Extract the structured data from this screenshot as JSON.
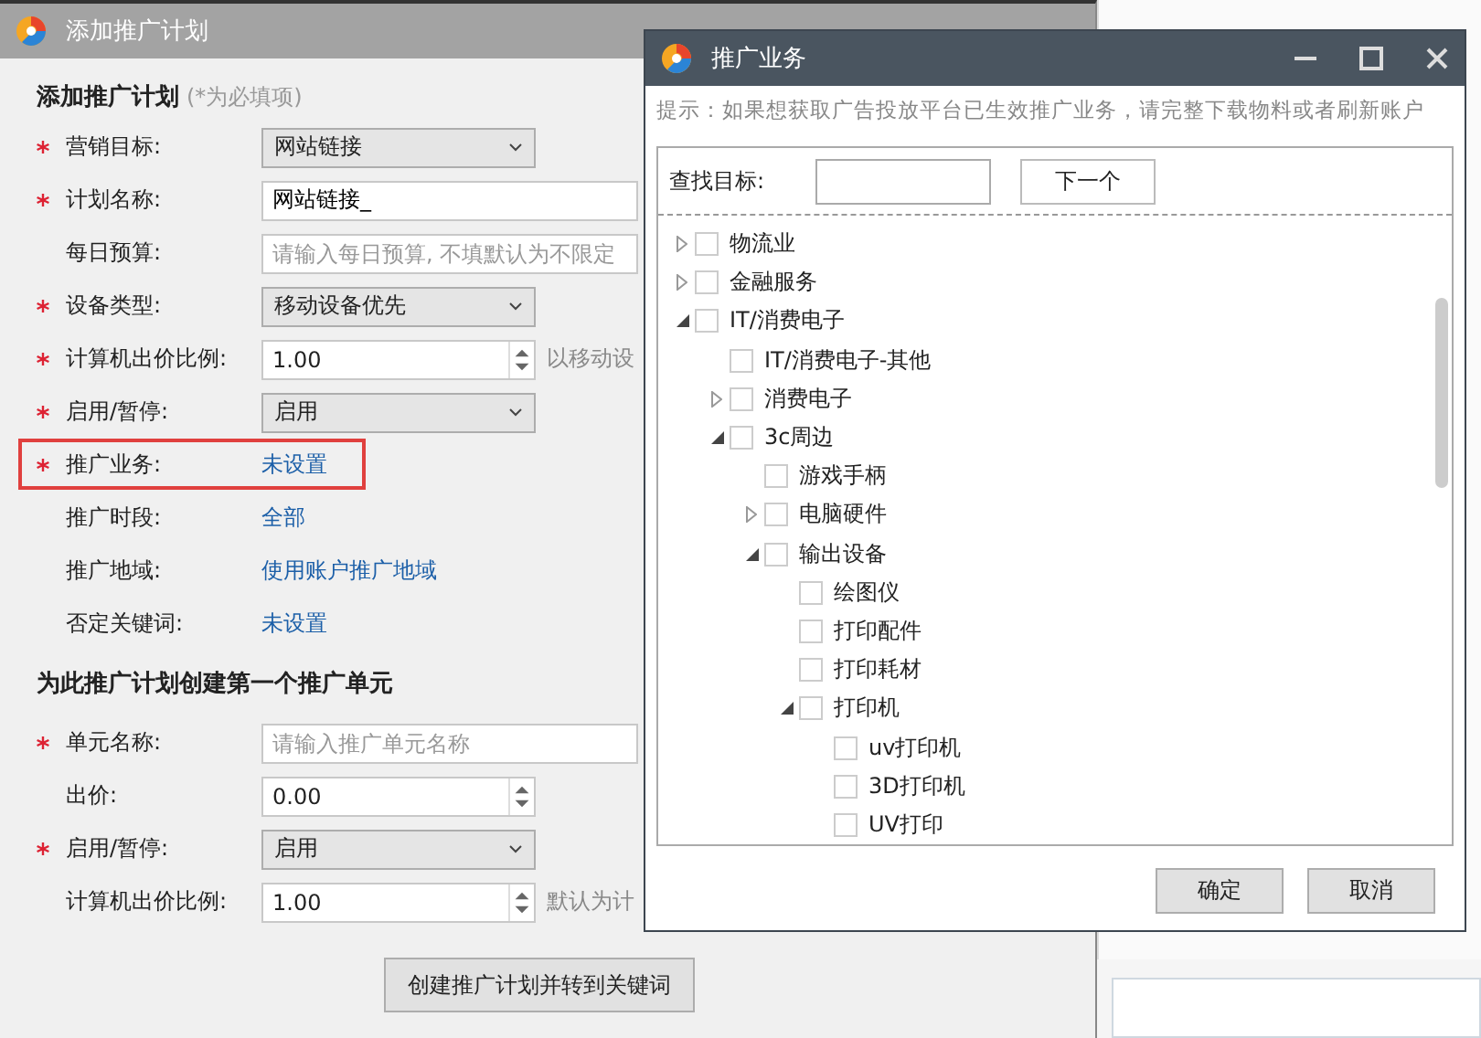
{
  "main_window": {
    "title": "添加推广计划",
    "heading": "添加推广计划",
    "heading_note": "(*为必填项)",
    "plan_fields": [
      {
        "kind": "select",
        "required": true,
        "label": "营销目标:",
        "value": "网站链接"
      },
      {
        "kind": "input",
        "required": true,
        "label": "计划名称:",
        "value": "网站链接_"
      },
      {
        "kind": "input",
        "required": false,
        "label": "每日预算:",
        "placeholder": "请输入每日预算, 不填默认为不限定"
      },
      {
        "kind": "select",
        "required": true,
        "label": "设备类型:",
        "value": "移动设备优先"
      },
      {
        "kind": "spinner",
        "required": true,
        "label": "计算机出价比例:",
        "value": "1.00",
        "hint": "以移动设"
      },
      {
        "kind": "select",
        "required": true,
        "label": "启用/暂停:",
        "value": "启用"
      },
      {
        "kind": "link",
        "required": true,
        "label": "推广业务:",
        "value": "未设置",
        "highlighted": true
      },
      {
        "kind": "link",
        "required": false,
        "label": "推广时段:",
        "value": "全部"
      },
      {
        "kind": "link",
        "required": false,
        "label": "推广地域:",
        "value": "使用账户推广地域"
      },
      {
        "kind": "link",
        "required": false,
        "label": "否定关键词:",
        "value": "未设置"
      }
    ],
    "unit_heading": "为此推广计划创建第一个推广单元",
    "unit_fields": [
      {
        "kind": "input",
        "required": true,
        "label": "单元名称:",
        "placeholder": "请输入推广单元名称"
      },
      {
        "kind": "spinner",
        "required": false,
        "label": "出价:",
        "value": "0.00"
      },
      {
        "kind": "select",
        "required": true,
        "label": "启用/暂停:",
        "value": "启用"
      },
      {
        "kind": "spinner",
        "required": false,
        "label": "计算机出价比例:",
        "value": "1.00",
        "hint": "默认为计"
      }
    ],
    "submit_button": "创建推广计划并转到关键词"
  },
  "popup": {
    "title": "推广业务",
    "tip": "提示：如果想获取广告投放平台已生效推广业务，请完整下载物料或者刷新账户",
    "search_label": "查找目标:",
    "next_button": "下一个",
    "tree": [
      {
        "label": "物流业",
        "checked": false,
        "expanded": false
      },
      {
        "label": "金融服务",
        "checked": false,
        "expanded": false
      },
      {
        "label": "IT/消费电子",
        "checked": false,
        "expanded": true,
        "children": [
          {
            "label": "IT/消费电子-其他",
            "checked": false
          },
          {
            "label": "消费电子",
            "checked": false,
            "expanded": false
          },
          {
            "label": "3c周边",
            "checked": false,
            "expanded": true,
            "children": [
              {
                "label": "游戏手柄",
                "checked": false
              },
              {
                "label": "电脑硬件",
                "checked": false,
                "expanded": false
              },
              {
                "label": "输出设备",
                "checked": false,
                "expanded": true,
                "children": [
                  {
                    "label": "绘图仪",
                    "checked": false
                  },
                  {
                    "label": "打印配件",
                    "checked": false
                  },
                  {
                    "label": "打印耗材",
                    "checked": false
                  },
                  {
                    "label": "打印机",
                    "checked": false,
                    "expanded": true,
                    "children": [
                      {
                        "label": "uv打印机",
                        "checked": false
                      },
                      {
                        "label": "3D打印机",
                        "checked": false
                      },
                      {
                        "label": "UV打印",
                        "checked": false
                      }
                    ]
                  }
                ]
              }
            ]
          }
        ]
      }
    ],
    "ok_button": "确定",
    "cancel_button": "取消"
  }
}
